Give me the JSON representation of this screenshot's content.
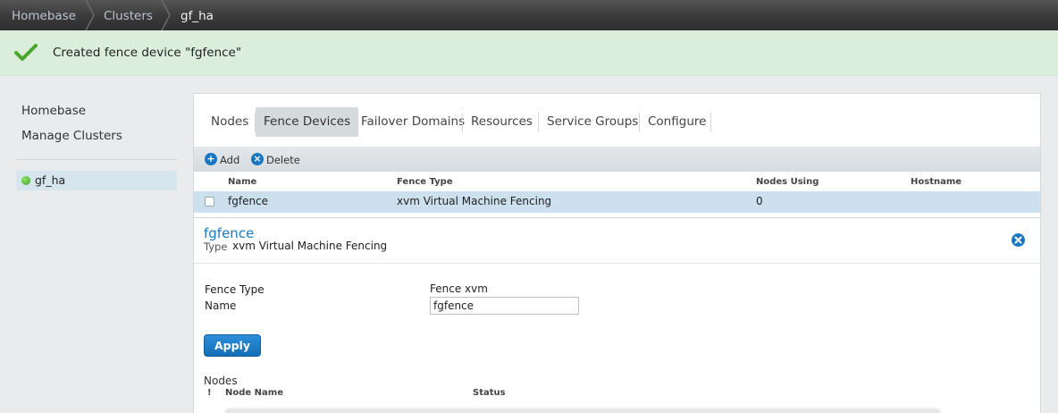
{
  "breadcrumb": {
    "items": [
      "Homebase",
      "Clusters",
      "gf_ha"
    ]
  },
  "notification": {
    "message": "Created fence device \"fgfence\"",
    "icon": "checkmark-icon"
  },
  "sidebar": {
    "links": [
      "Homebase",
      "Manage Clusters"
    ],
    "clusters": [
      {
        "name": "gf_ha",
        "status_color": "#3aa11d"
      }
    ]
  },
  "tabs": [
    {
      "label": "Nodes",
      "active": false
    },
    {
      "label": "Fence Devices",
      "active": true
    },
    {
      "label": "Failover Domains",
      "active": false
    },
    {
      "label": "Resources",
      "active": false
    },
    {
      "label": "Service Groups",
      "active": false
    },
    {
      "label": "Configure",
      "active": false
    }
  ],
  "toolbar": {
    "add_label": "Add",
    "delete_label": "Delete"
  },
  "table": {
    "columns": [
      "Name",
      "Fence Type",
      "Nodes Using",
      "Hostname"
    ],
    "rows": [
      {
        "name": "fgfence",
        "fence_type": "xvm Virtual Machine Fencing",
        "nodes_using": "0",
        "hostname": ""
      }
    ]
  },
  "detail": {
    "title": "fgfence",
    "type_label": "Type",
    "type_value": "xvm Virtual Machine Fencing",
    "fence_type_label": "Fence Type",
    "fence_type_value": "Fence xvm",
    "name_label": "Name",
    "name_value": "fgfence",
    "apply_label": "Apply",
    "nodes_heading": "Nodes",
    "nodes_columns": [
      "!",
      "Node Name",
      "Status"
    ]
  },
  "colors": {
    "accent": "#1a76c2",
    "notice_bg": "#dbeedc",
    "selected_row": "#cde0ee"
  }
}
